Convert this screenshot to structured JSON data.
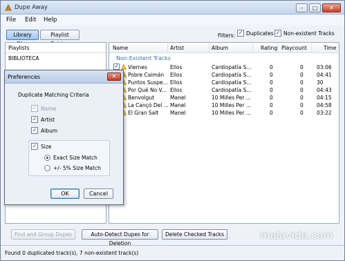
{
  "window": {
    "title": "Dupe Away"
  },
  "menu": [
    "File",
    "Edit",
    "Help"
  ],
  "tabs": [
    "Library Files",
    "Playlist Entries"
  ],
  "filters": {
    "label": "Filters:",
    "duplicates": "Duplicates",
    "nonexistent": "Non-existent Tracks"
  },
  "playlists": {
    "header": "Playlists",
    "items": [
      "BIBLIOTECA"
    ]
  },
  "grid": {
    "columns": [
      "Name",
      "Artist",
      "Album",
      "Rating",
      "Playcount",
      "Time"
    ],
    "group": "Non-Existent Tracks",
    "rows": [
      {
        "name": "Viernes",
        "artist": "Ellos",
        "album": "Cardiopatía S...",
        "rating": "0",
        "playcount": "0",
        "time": "03:06"
      },
      {
        "name": "Pobre Caimán",
        "artist": "Ellos",
        "album": "Cardiopatía S...",
        "rating": "0",
        "playcount": "0",
        "time": "04:41"
      },
      {
        "name": "Puntos Suspe...",
        "artist": "Ellos",
        "album": "Cardiopatía S...",
        "rating": "0",
        "playcount": "0",
        "time": "30"
      },
      {
        "name": "Por Qué No V...",
        "artist": "Ellos",
        "album": "Cardiopatía S...",
        "rating": "0",
        "playcount": "0",
        "time": "04:43"
      },
      {
        "name": "Benvolgut",
        "artist": "Manel",
        "album": "10 Milles Per ...",
        "rating": "0",
        "playcount": "0",
        "time": "04:15"
      },
      {
        "name": "La Cançó Del ...",
        "artist": "Manel",
        "album": "10 Milles Per ...",
        "rating": "0",
        "playcount": "0",
        "time": "04:58"
      },
      {
        "name": "El Gran Salt",
        "artist": "Manel",
        "album": "10 Milles Per ...",
        "rating": "0",
        "playcount": "0",
        "time": "03:22"
      }
    ]
  },
  "buttons": {
    "find": "Find and Group Dupes",
    "autodetect": "Auto-Detect Dupes for Deletion",
    "delete": "Delete Checked Tracks"
  },
  "status": "Found 0 duplicated track(s), 7 non-existent track(s)",
  "dialog": {
    "title": "Preferences",
    "section": "Duplicate Matching Criteria",
    "name": "Name",
    "artist": "Artist",
    "album": "Album",
    "size": "Size",
    "exact": "Exact Size Match",
    "approx": "+/- 5% Size Match",
    "ok": "OK",
    "cancel": "Cancel"
  },
  "watermark": "malavida.com"
}
